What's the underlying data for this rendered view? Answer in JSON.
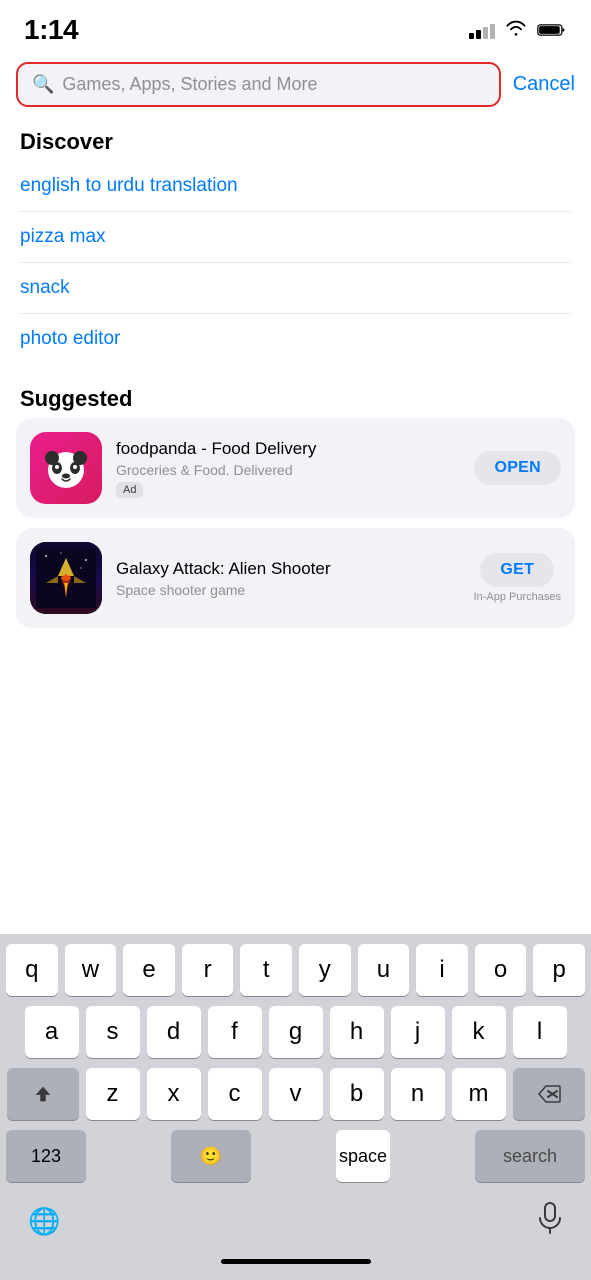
{
  "statusBar": {
    "time": "1:14"
  },
  "searchBar": {
    "placeholder": "Games, Apps, Stories and More",
    "cancelLabel": "Cancel"
  },
  "discover": {
    "title": "Discover",
    "items": [
      {
        "label": "english to urdu translation"
      },
      {
        "label": "pizza max"
      },
      {
        "label": "snack"
      },
      {
        "label": "photo editor"
      }
    ]
  },
  "suggested": {
    "title": "Suggested",
    "apps": [
      {
        "name": "foodpanda - Food Delivery",
        "desc": "Groceries & Food. Delivered",
        "badge": "Ad",
        "action": "OPEN",
        "type": "foodpanda"
      },
      {
        "name": "Galaxy Attack: Alien Shooter",
        "desc": "Space shooter game",
        "badge": null,
        "action": "GET",
        "inApp": "In-App Purchases",
        "type": "galaxy"
      }
    ]
  },
  "keyboard": {
    "rows": [
      [
        "q",
        "w",
        "e",
        "r",
        "t",
        "y",
        "u",
        "i",
        "o",
        "p"
      ],
      [
        "a",
        "s",
        "d",
        "f",
        "g",
        "h",
        "j",
        "k",
        "l"
      ],
      [
        "z",
        "x",
        "c",
        "v",
        "b",
        "n",
        "m"
      ]
    ],
    "num_label": "123",
    "space_label": "space",
    "search_label": "search"
  }
}
